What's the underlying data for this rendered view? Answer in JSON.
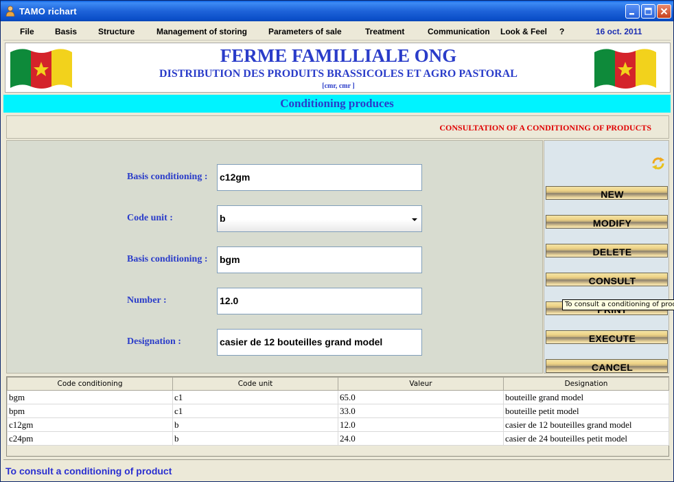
{
  "window": {
    "title": "TAMO richart"
  },
  "menu": {
    "items": [
      {
        "label": "File"
      },
      {
        "label": "Basis"
      },
      {
        "label": "Structure"
      },
      {
        "label": "Management of storing"
      },
      {
        "label": "Parameters of sale"
      },
      {
        "label": "Treatment"
      },
      {
        "label": "Communication"
      },
      {
        "label": "Look & Feel"
      },
      {
        "label": "?"
      }
    ],
    "date": "16 oct. 2011"
  },
  "banner": {
    "title": "FERME FAMILLIALE ONG",
    "subtitle": "DISTRIBUTION DES PRODUITS BRASSICOLES ET AGRO PASTORAL",
    "location": "[cmr, cmr                ]"
  },
  "section": {
    "title": "Conditioning produces"
  },
  "consult_header": "CONSULTATION OF A CONDITIONING OF PRODUCTS",
  "form": {
    "fields": [
      {
        "label": "Basis conditioning :",
        "value": "c12gm"
      },
      {
        "label": "Code unit :",
        "value": "b"
      },
      {
        "label": "Basis conditioning :",
        "value": "bgm"
      },
      {
        "label": "Number :",
        "value": "12.0"
      },
      {
        "label": "Designation :",
        "value": "casier de 12 bouteilles grand model"
      }
    ]
  },
  "actions": [
    {
      "label": "NEW"
    },
    {
      "label": "MODIFY"
    },
    {
      "label": "DELETE"
    },
    {
      "label": "CONSULT"
    },
    {
      "label": "PRINT"
    },
    {
      "label": "EXECUTE"
    },
    {
      "label": "CANCEL"
    }
  ],
  "tooltip": "To consult a conditioning of product",
  "table": {
    "headers": [
      "Code conditioning",
      "Code unit",
      "Valeur",
      "Designation"
    ],
    "rows": [
      [
        "bgm",
        "c1",
        "65.0",
        "bouteille grand model"
      ],
      [
        "bpm",
        "c1",
        "33.0",
        "bouteille petit model"
      ],
      [
        "c12gm",
        "b",
        "12.0",
        "casier de 12 bouteilles grand model"
      ],
      [
        "c24pm",
        "b",
        "24.0",
        "casier de 24 bouteilles petit model"
      ]
    ]
  },
  "status": "To consult a conditioning of product",
  "colors": {
    "accent_blue": "#2A3CC9",
    "section_cyan": "#00F3FF",
    "alert_red": "#E00000"
  }
}
